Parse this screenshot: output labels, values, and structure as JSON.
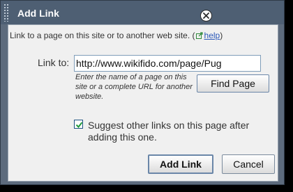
{
  "dialog": {
    "title": "Add Link",
    "intro_text": "Link to a page on this site or to another web site.",
    "help_open": "(",
    "help_link": "help",
    "help_close": ")",
    "link_label": "Link to:",
    "link_value": "http://www.wikifido.com/page/Pug",
    "hint": "Enter the name of a page on this site or a complete URL for another website.",
    "find_button": "Find Page",
    "suggest_checked": true,
    "suggest_label": "Suggest other links on this page after adding this one.",
    "add_button": "Add Link",
    "cancel_button": "Cancel"
  },
  "icons": {
    "close": "close-icon",
    "external": "external-link-icon",
    "check": "checkmark-icon",
    "grip": "grip-icon"
  },
  "colors": {
    "titlebar": "#4e5f73",
    "frame": "#5d6b7d",
    "panel": "#f0f0f0",
    "link": "#2a57b8",
    "check": "#1f9a3a"
  }
}
